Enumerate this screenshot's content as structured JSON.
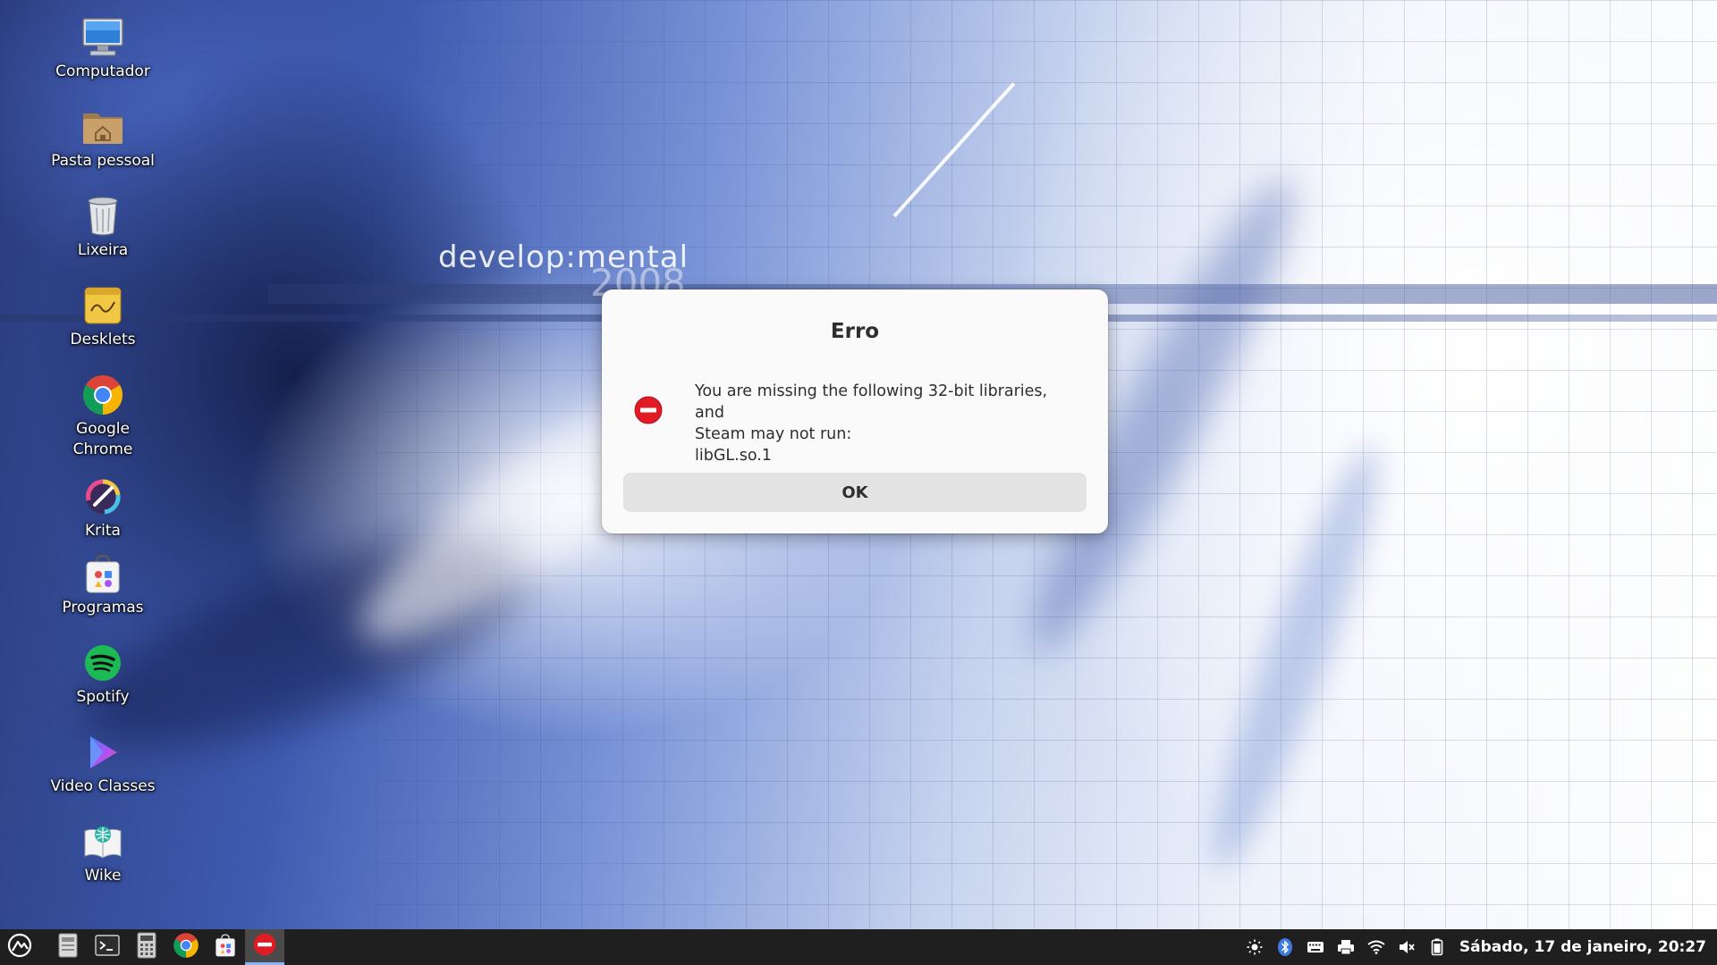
{
  "wallpaper": {
    "text": "develop:mental",
    "number": "2008"
  },
  "desktop": {
    "icons": [
      {
        "label": "Computador",
        "icon": "computer-icon"
      },
      {
        "label": "Pasta pessoal",
        "icon": "home-folder-icon"
      },
      {
        "label": "Lixeira",
        "icon": "trash-icon"
      },
      {
        "label": "Desklets",
        "icon": "desklets-icon"
      },
      {
        "label": "Google Chrome",
        "icon": "chrome-icon"
      },
      {
        "label": "Krita",
        "icon": "krita-icon"
      },
      {
        "label": "Programas",
        "icon": "software-store-icon"
      },
      {
        "label": "Spotify",
        "icon": "spotify-icon"
      },
      {
        "label": "Video Classes",
        "icon": "video-classes-icon"
      },
      {
        "label": "Wike",
        "icon": "wike-icon"
      }
    ]
  },
  "dialog": {
    "title": "Erro",
    "message_line1": "You are missing the following 32-bit libraries, and",
    "message_line2": "Steam may not run:",
    "message_line3": "libGL.so.1",
    "ok_label": "OK",
    "icon": "error-icon"
  },
  "taskbar": {
    "launchers": [
      "menu-icon",
      "file-manager-icon",
      "terminal-icon",
      "calculator-icon",
      "chrome-icon",
      "software-store-icon",
      "error-window-icon"
    ],
    "tray": [
      "brightness-icon",
      "bluetooth-icon",
      "keyboard-icon",
      "printer-icon",
      "wifi-icon",
      "volume-muted-icon",
      "battery-icon"
    ],
    "clock": "Sábado, 17 de janeiro, 20:27"
  },
  "colors": {
    "dialog_bg": "#fafafa",
    "button_bg": "#e3e3e3",
    "error_red": "#e01b24",
    "taskbar_bg": "#1f1f1f"
  }
}
